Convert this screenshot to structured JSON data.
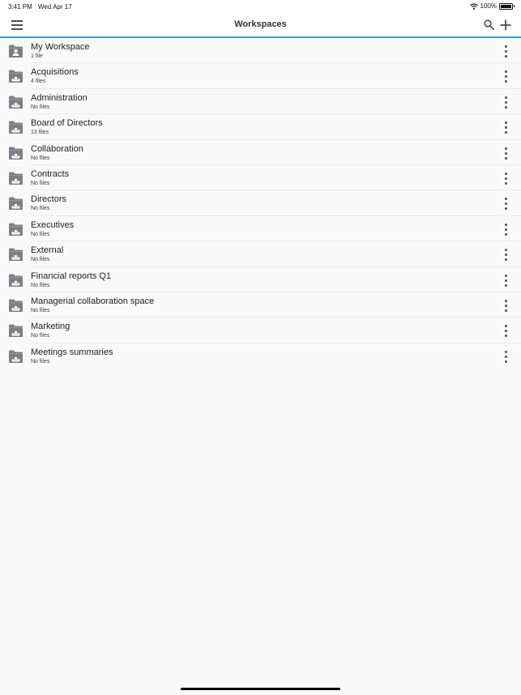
{
  "status_bar": {
    "time": "3:41 PM",
    "date": "Wed Apr 17",
    "battery": "100%"
  },
  "header": {
    "title": "Workspaces",
    "menu_icon": "hamburger-menu-icon",
    "search_icon": "search-icon",
    "add_icon": "plus-icon",
    "accent_color": "#2f9fd8"
  },
  "workspaces": [
    {
      "name": "My Workspace",
      "count": "1 file",
      "icon": "personal-folder-icon"
    },
    {
      "name": "Acquisitions",
      "count": "4 files",
      "icon": "shared-folder-icon"
    },
    {
      "name": "Administration",
      "count": "No files",
      "icon": "shared-folder-icon"
    },
    {
      "name": "Board of Directors",
      "count": "13 files",
      "icon": "shared-folder-icon"
    },
    {
      "name": "Collaboration",
      "count": "No files",
      "icon": "shared-folder-icon"
    },
    {
      "name": "Contracts",
      "count": "No files",
      "icon": "shared-folder-icon"
    },
    {
      "name": "Directors",
      "count": "No files",
      "icon": "shared-folder-icon"
    },
    {
      "name": "Executives",
      "count": "No files",
      "icon": "shared-folder-icon"
    },
    {
      "name": "External",
      "count": "No files",
      "icon": "shared-folder-icon"
    },
    {
      "name": "Financial reports Q1",
      "count": "No files",
      "icon": "shared-folder-icon"
    },
    {
      "name": "Managerial collaboration space",
      "count": "No files",
      "icon": "shared-folder-icon"
    },
    {
      "name": "Marketing",
      "count": "No files",
      "icon": "shared-folder-icon"
    },
    {
      "name": "Meetings summaries",
      "count": "No files",
      "icon": "shared-folder-icon"
    }
  ]
}
